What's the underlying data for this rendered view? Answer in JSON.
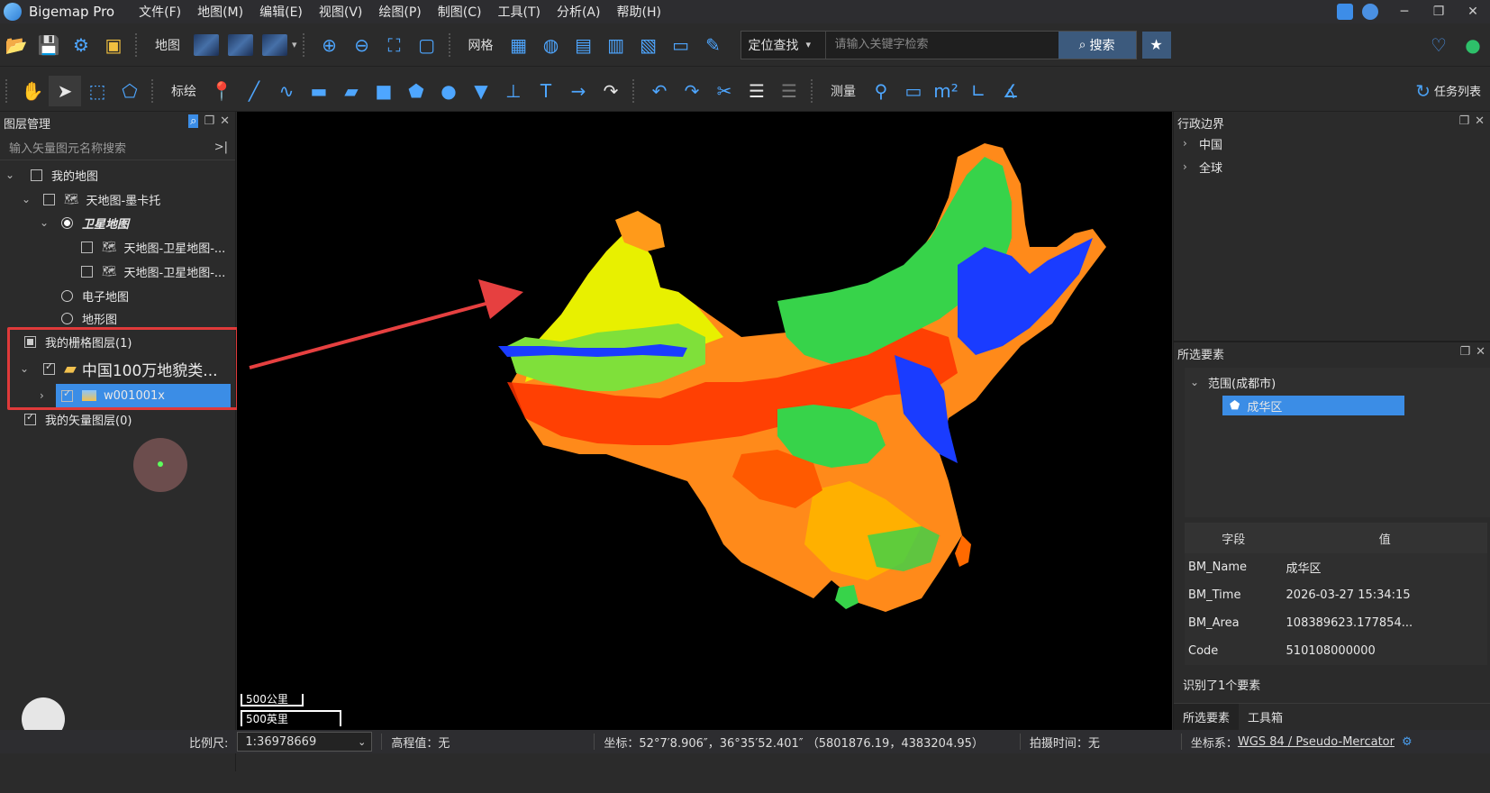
{
  "app": {
    "title": "Bigemap Pro"
  },
  "menu": [
    "文件(F)",
    "地图(M)",
    "编辑(E)",
    "视图(V)",
    "绘图(P)",
    "制图(C)",
    "工具(T)",
    "分析(A)",
    "帮助(H)"
  ],
  "toolbar1": {
    "map_label": "地图",
    "grid_label": "网格",
    "search_type": "定位查找",
    "search_placeholder": "请输入关键字检索",
    "search_button": "搜索"
  },
  "toolbar2": {
    "draw_label": "标绘",
    "measure_label": "测量",
    "task_list": "任务列表"
  },
  "layer_panel": {
    "title": "图层管理",
    "filter_placeholder": "输入矢量图元名称搜索",
    "my_map": "我的地图",
    "tianditu_mercator": "天地图-墨卡托",
    "satellite": "卫星地图",
    "sat_layer_1": "天地图-卫星地图-...",
    "sat_layer_2": "天地图-卫星地图-...",
    "electronic": "电子地图",
    "terrain": "地形图",
    "raster_group": "我的栅格图层(1)",
    "raster_folder": "中国100万地貌类...",
    "raster_item": "w001001x",
    "vector_group": "我的矢量图层(0)"
  },
  "map": {
    "scale_km": "500公里",
    "scale_mi": "500英里"
  },
  "admin_panel": {
    "title": "行政边界",
    "items": [
      "中国",
      "全球"
    ]
  },
  "selected_panel": {
    "title": "所选要素",
    "group": "范围(成都市)",
    "item": "成华区",
    "col_field": "字段",
    "col_value": "值",
    "rows": [
      {
        "field": "BM_Name",
        "value": "成华区"
      },
      {
        "field": "BM_Time",
        "value": "2026-03-27 15:34:15"
      },
      {
        "field": "BM_Area",
        "value": "108389623.177854..."
      },
      {
        "field": "Code",
        "value": "510108000000"
      }
    ],
    "summary": "识别了1个要素",
    "tabs": [
      "所选要素",
      "工具箱"
    ]
  },
  "status": {
    "scale_label": "比例尺:",
    "scale_value": "1:36978669",
    "elevation": "高程值：无",
    "coords": "坐标：52°7′8.906″，36°35′52.401″ （5801876.19，4383204.95）",
    "capture_time": "拍摄时间：无",
    "crs_label": "坐标系：",
    "crs_value": "WGS 84 / Pseudo-Mercator"
  }
}
